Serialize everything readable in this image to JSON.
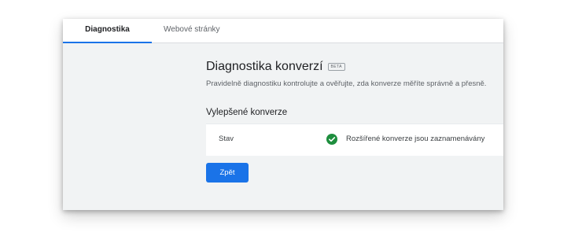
{
  "tabs": [
    {
      "label": "Diagnostika",
      "active": true
    },
    {
      "label": "Webové stránky",
      "active": false
    }
  ],
  "header": {
    "title": "Diagnostika konverzí",
    "badge": "BETA",
    "subtitle": "Pravidelně diagnostiku kontrolujte a ověřujte, zda konverze měříte správně a přesně."
  },
  "section": {
    "title": "Vylepšené konverze",
    "status_label": "Stav",
    "status_icon": "check-circle-icon",
    "status_text": "Rozšířené konverze jsou zaznamenávány",
    "status_color": "#1e8e3e"
  },
  "actions": {
    "back_label": "Zpět"
  },
  "colors": {
    "accent": "#1a73e8",
    "background": "#f1f3f4"
  }
}
